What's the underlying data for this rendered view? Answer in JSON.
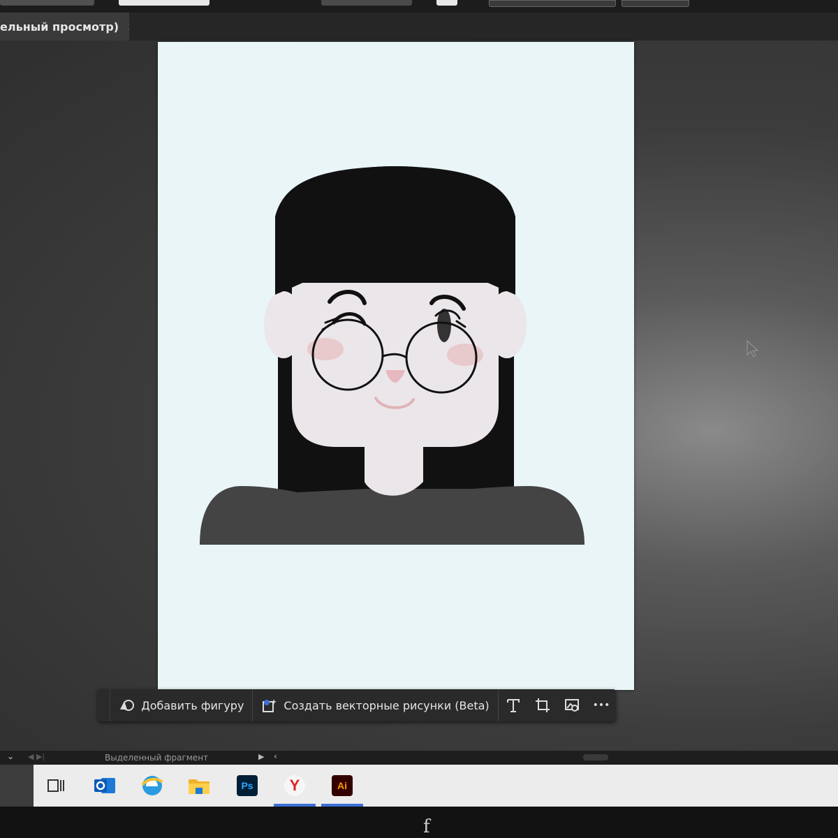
{
  "document_tab": {
    "title": "ельный просмотр)",
    "close_label": "×"
  },
  "context_bar": {
    "add_shape_label": "Добавить фигуру",
    "generate_vector_label": "Создать векторные рисунки (Beta)",
    "more_label": "•••"
  },
  "status_bar": {
    "collapse_glyph": "⌄",
    "nav_glyph": "◀ ▶|",
    "selection_label": "Выделенный фрагмент",
    "play_glyph": "▶",
    "back_glyph": "‹"
  },
  "taskbar": {
    "photoshop_label": "Ps",
    "yandex_label": "Y",
    "illustrator_label": "Ai"
  },
  "bezel": {
    "logo_glyph": "f"
  },
  "colors": {
    "artboard_bg": "#e9f5f7",
    "hair": "#111111",
    "skin": "#ebe6ea",
    "cheeks": "#e8c9cc",
    "sweater": "#444444",
    "glasses": "#111111",
    "accent_blue": "#3b6fd6"
  },
  "icons": [
    "close-icon",
    "shape-icon",
    "sparkle-vector-icon",
    "text-tool-icon",
    "crop-artboard-icon",
    "image-trace-icon",
    "more-icon",
    "cursor-icon",
    "task-view-icon",
    "outlook-icon",
    "edge-icon",
    "file-explorer-icon",
    "photoshop-icon",
    "yandex-browser-icon",
    "illustrator-icon"
  ]
}
